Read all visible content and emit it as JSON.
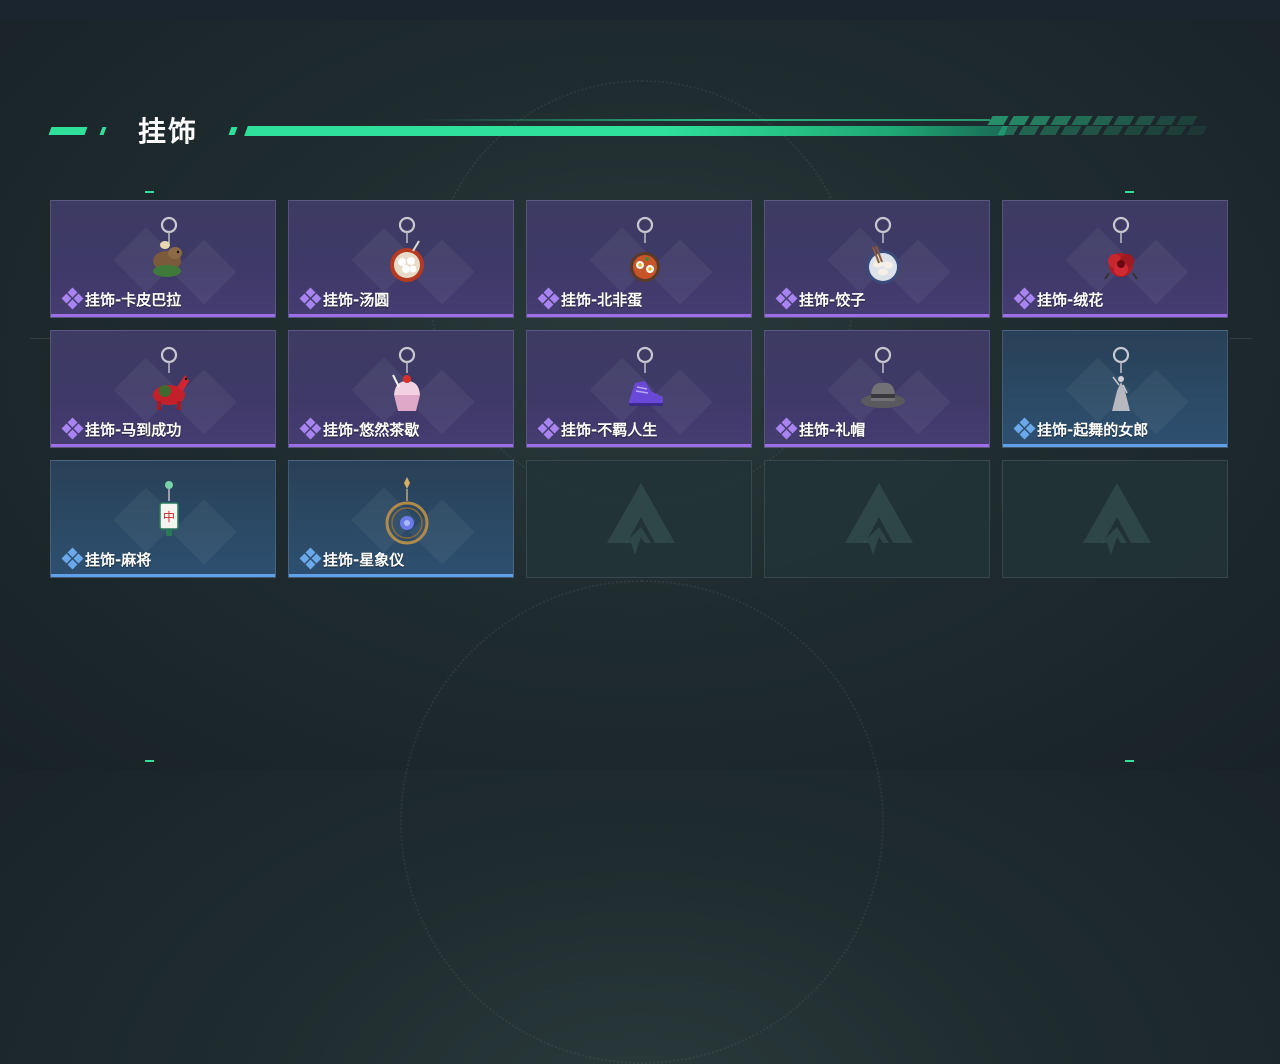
{
  "header": {
    "title": "挂饰"
  },
  "theme": {
    "accent": "#2ee09a",
    "rare_purple": "#9c6ee8",
    "rare_blue": "#5fa0e8"
  },
  "items": [
    {
      "label": "挂饰-卡皮巴拉",
      "rarity": "purple",
      "icon": "capybara-charm-icon"
    },
    {
      "label": "挂饰-汤圆",
      "rarity": "purple",
      "icon": "tangyuan-charm-icon"
    },
    {
      "label": "挂饰-北非蛋",
      "rarity": "purple",
      "icon": "shakshuka-charm-icon"
    },
    {
      "label": "挂饰-饺子",
      "rarity": "purple",
      "icon": "dumplings-charm-icon"
    },
    {
      "label": "挂饰-绒花",
      "rarity": "purple",
      "icon": "velvet-flower-charm-icon"
    },
    {
      "label": "挂饰-马到成功",
      "rarity": "purple",
      "icon": "horse-charm-icon"
    },
    {
      "label": "挂饰-悠然茶歇",
      "rarity": "purple",
      "icon": "cupcake-charm-icon"
    },
    {
      "label": "挂饰-不羁人生",
      "rarity": "purple",
      "icon": "sneaker-charm-icon"
    },
    {
      "label": "挂饰-礼帽",
      "rarity": "purple",
      "icon": "fedora-charm-icon"
    },
    {
      "label": "挂饰-起舞的女郎",
      "rarity": "blue",
      "icon": "dancer-charm-icon"
    },
    {
      "label": "挂饰-麻将",
      "rarity": "blue",
      "icon": "mahjong-charm-icon"
    },
    {
      "label": "挂饰-星象仪",
      "rarity": "blue",
      "icon": "astrolabe-charm-icon"
    }
  ],
  "empty_slots": 3,
  "empty_icon": "placeholder-logo-icon"
}
